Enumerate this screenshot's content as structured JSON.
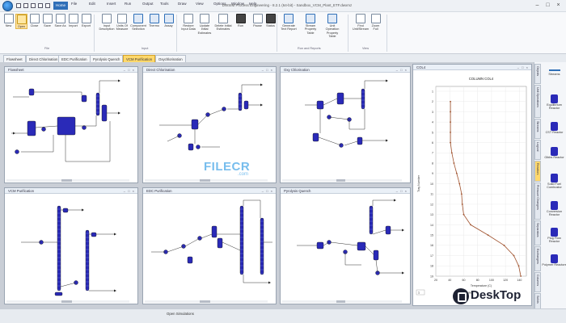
{
  "titlebar": {
    "title": "DWSIM Process Engineering - 8.2.1 (64-bit) - Sandbox_VCM_Plant_ETF.dwxmz",
    "menu": [
      "Home",
      "File",
      "Edit",
      "Insert",
      "Run",
      "Output",
      "Tools",
      "Draw",
      "View",
      "Options",
      "Window",
      "Help"
    ],
    "active_menu_index": 0
  },
  "ribbon": {
    "groups": [
      {
        "label": "File",
        "buttons": [
          "New",
          "Open",
          "Close",
          "Save",
          "Save As",
          "Import",
          "Export"
        ]
      },
      {
        "label": "Input",
        "buttons": [
          "Input Description",
          "Units Of Measure",
          "Component Selection",
          "Thermo",
          "Assay"
        ]
      },
      {
        "label": "",
        "buttons": [
          "Restore Input Data",
          "Update Initial Estimates",
          "Delete Initial Estimates",
          "Run",
          "Pause",
          "Status"
        ]
      },
      {
        "label": "Run and Reports",
        "buttons": [
          "Generate Text Report",
          "Stream Property Table",
          "Unit Operation Property Table"
        ]
      },
      {
        "label": "View",
        "buttons": [
          "Find Unit/Stream",
          "Zoom Full"
        ]
      }
    ]
  },
  "tabs": [
    "Flowsheet",
    "Direct Chlorination",
    "EDC Purification",
    "Pyrolysis Quench",
    "VCM Purification",
    "Oxychlorination"
  ],
  "active_tab_index": 4,
  "panes": [
    {
      "title": "Flowsheet"
    },
    {
      "title": "Direct Chlorination"
    },
    {
      "title": "Oxy Chlorination"
    },
    {
      "title": "VCM Purification"
    },
    {
      "title": "EDC Purification"
    },
    {
      "title": "Pyrolysis Quench"
    }
  ],
  "chart_pane": {
    "title": "COL4",
    "chart_title": "COLUMN COL4",
    "footer": "Temperature",
    "page_value": "1"
  },
  "chart_data": {
    "type": "line",
    "title": "COLUMN COL4",
    "xlabel": "Temperature (C)",
    "ylabel": "Tray Number",
    "xlim": [
      20,
      150
    ],
    "ylim": [
      1,
      19
    ],
    "y_reversed": true,
    "x_ticks": [
      20,
      40,
      60,
      80,
      100,
      120,
      140
    ],
    "y_ticks": [
      1,
      2,
      3,
      4,
      5,
      6,
      7,
      8,
      9,
      10,
      11,
      12,
      13,
      14,
      15,
      16,
      17,
      18,
      19
    ],
    "series": [
      {
        "x": [
          41,
          41,
          41,
          41,
          41,
          43,
          46,
          50,
          54,
          57,
          58,
          60,
          70,
          95,
          118,
          132,
          139,
          142
        ],
        "y": [
          2,
          3,
          4,
          5,
          6,
          7,
          8,
          9,
          10,
          11,
          12,
          13,
          14,
          15,
          16,
          17,
          18,
          19
        ],
        "color": "#a0522d"
      }
    ],
    "grid": true
  },
  "rpanel": {
    "tabs": [
      "Objects",
      "Unit Operations",
      "Streams",
      "Logical",
      "Reactors",
      "Pressure Changers",
      "Separators",
      "Exchangers",
      "Columns",
      "Solids",
      "Other"
    ],
    "active_tab_index": 4,
    "objects": [
      "Streams",
      "Equilibrium Reactor",
      "CST Reactor",
      "Gibbs Reactor",
      "Solid Fuel Combustor",
      "Conversion Reactor",
      "Plug Flow Reactor",
      "Polymer Reactors"
    ]
  },
  "status": {
    "text": "Open Simulations"
  },
  "watermarks": {
    "filecr": "FILECR",
    "filecr_sub": ".com",
    "desktop": "DeskTop"
  },
  "colors": {
    "accent": "#2f6fb8",
    "equipment": "#2a2ab8",
    "active_tab": "#ffd86b",
    "curve": "#a0522d"
  }
}
